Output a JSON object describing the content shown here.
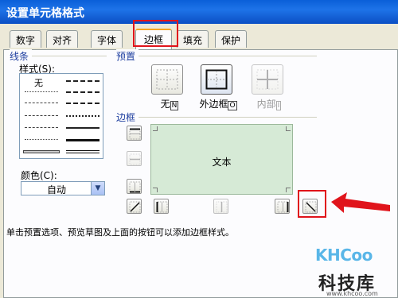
{
  "window": {
    "title": "设置单元格格式"
  },
  "tabs": [
    "数字",
    "对齐",
    "字体",
    "边框",
    "填充",
    "保护"
  ],
  "active_tab": "边框",
  "line_section": {
    "title": "线条",
    "style_label": "样式(S):",
    "none_label": "无"
  },
  "color": {
    "label": "颜色(C):",
    "value": "自动"
  },
  "presets": {
    "title": "预置",
    "items": [
      {
        "label": "无",
        "key": "N",
        "enabled": true
      },
      {
        "label": "外边框",
        "key": "O",
        "enabled": true
      },
      {
        "label": "内部",
        "key": "I",
        "enabled": false
      }
    ]
  },
  "border": {
    "title": "边框",
    "preview_text": "文本"
  },
  "note": "单击预置选项、预览草图及上面的按钮可以添加边框样式。",
  "watermark": {
    "logo": "KHCoo",
    "name": "科技库",
    "url": "www.khcoo.com"
  },
  "colors": {
    "highlight": "#e0141b",
    "preview_bg": "#d6ead6",
    "title_bar": "#0a5fd8"
  }
}
